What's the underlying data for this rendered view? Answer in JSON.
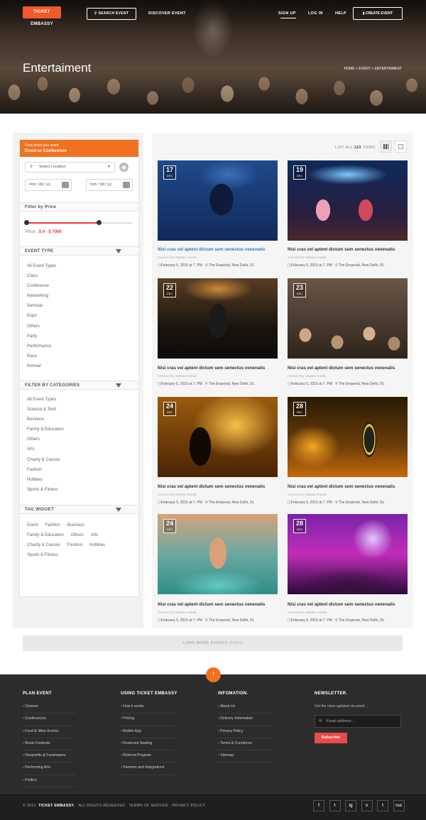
{
  "header": {
    "logo": "TICKET EMBASSY",
    "search_button": "SEARCH EVENT",
    "discover": "DISCOVER EVENT",
    "sign_up": "SIGN UP",
    "log_in": "LOG IN",
    "help": "HELP",
    "create_event": "CREATE EVENT"
  },
  "hero": {
    "title": "Entertaiment",
    "breadcrumb": "HOME > EVENT > ENTERTAIMENT"
  },
  "sidebar": {
    "find_line1": "Find what you want",
    "find_line2": "Event or Conference",
    "location_placeholder": "Select Location",
    "date_from": "mm / dd / yy",
    "date_to": "mm / dd / yy",
    "filter_price": "Filter by Price",
    "price_label": "Price :",
    "price_range": "$ 0 - $ 7000",
    "price_fraction_min": 0.0,
    "price_fraction_max": 0.7,
    "event_type_title": "EVENT TYPE",
    "event_types": [
      "All Event Types",
      "Class",
      "Conference",
      "Networking",
      "Seminar",
      "Expo",
      "Others",
      "Party",
      "Performance",
      "Race",
      "Retreat"
    ],
    "categories_title": "FILTER BY CATEGORIES",
    "categories": [
      "All Event Types",
      "Science & Tech",
      "Business",
      "Family & Education",
      "Others",
      "Arts",
      "Charity & Causes",
      "Fashion",
      "Hobbies",
      "Sports & Fitness"
    ],
    "tag_title": "TAG WIDGET",
    "tags": [
      "Event",
      "Fashion",
      "Business",
      "Family & Education",
      "Others",
      "Arts",
      "Charity & Causes",
      "Fashion",
      "Hobbies",
      "Sports & Fitness"
    ]
  },
  "listing": {
    "list_all": "LIST ALL",
    "count": "123",
    "items": "ITEMS",
    "load_more": "LOAD MORE EVENTS (113+)"
  },
  "events": [
    {
      "day": "17",
      "month": "DEC",
      "title": "Nisi cras vel aptent dictum sem senectus venenatis",
      "by": "Concert by Salwan media",
      "date": "February 5, 2015 at 7. PM",
      "venue": "The Emperial, New Delhi, DL",
      "img": "concert-jump"
    },
    {
      "day": "19",
      "month": "DEC",
      "title": "Nisi cras vel aptent dictum sem senectus venenatis",
      "by": "Concert by Salwan media",
      "date": "February 5, 2015 at 7. PM",
      "venue": "The Emperial, New Delhi, DL",
      "img": "dance-stage"
    },
    {
      "day": "22",
      "month": "DEC",
      "title": "Nisi cras vel aptent dictum sem senectus venenatis",
      "by": "Concert by Salwan media",
      "date": "February 5, 2015 at 7. PM",
      "venue": "The Emperial, New Delhi, DL",
      "img": "guitarist"
    },
    {
      "day": "23",
      "month": "DEC",
      "title": "Nisi cras vel aptent dictum sem senectus venenatis",
      "by": "Concert by Salwan media",
      "date": "February 5, 2015 at 7. PM",
      "venue": "The Emperial, New Delhi, DL",
      "img": "crowd"
    },
    {
      "day": "24",
      "month": "DEC",
      "title": "Nisi cras vel aptent dictum sem senectus venenatis",
      "by": "Concert by Salwan media",
      "date": "February 5, 2015 at 7. PM",
      "venue": "The Emperial, New Delhi, DL",
      "img": "saxophone"
    },
    {
      "day": "28",
      "month": "DEC",
      "title": "Nisi cras vel aptent dictum sem senectus venenatis",
      "by": "Concert by Salwan media",
      "date": "February 5, 2015 at 7. PM",
      "venue": "The Emperial, New Delhi, DL",
      "img": "singer"
    },
    {
      "day": "24",
      "month": "DEC",
      "title": "Nisi cras vel aptent dictum sem senectus venenatis",
      "by": "Concert by Salwan media",
      "date": "February 5, 2015 at 7. PM",
      "venue": "The Emperial, New Delhi, DL",
      "img": "pool-party"
    },
    {
      "day": "28",
      "month": "DEC",
      "title": "Nisi cras vel aptent dictum sem senectus venenatis",
      "by": "Concert by Salwan media",
      "date": "February 5, 2015 at 7. PM",
      "venue": "The Emperial, New Delhi, DL",
      "img": "lights-show"
    }
  ],
  "footer": {
    "plan_title": "PLAN EVENT",
    "plan": [
      "Classes",
      "Conferences",
      "Food & Wine Events",
      "Music Festivals",
      "Nonprofits & Fundraisers",
      "Performing Arts",
      "Politics"
    ],
    "using_title": "USING TICKET EMBASSY",
    "using": [
      "How it works",
      "Pricing",
      "Mobile App",
      "Reserved Seating",
      "Referral Program",
      "Partners and Integrations"
    ],
    "info_title": "INFOMATION.",
    "info": [
      "About Us",
      "Delivery Information",
      "Privacy Policy",
      "Terms & Conditions",
      "Sitemap"
    ],
    "newsletter_title": "NEWSLETTER.",
    "newsletter_text": "Get the news updated via email ...",
    "email_placeholder": "Email address...",
    "subscribe": "Subscribe",
    "copyright_year": "© 2015",
    "brand": "TICKET EMBASSY.",
    "rights": "ALL RIGHTS RESERVED",
    "terms": "TERMS OF SERVICE",
    "privacy": "PRIVACY POLICY",
    "social": [
      "f",
      "t",
      "ig",
      "v",
      "t",
      "rss"
    ]
  },
  "colors": {
    "accent": "#f07221",
    "price": "#e53935",
    "subscribe": "#e94b4b",
    "link": "#2a7ec0"
  }
}
